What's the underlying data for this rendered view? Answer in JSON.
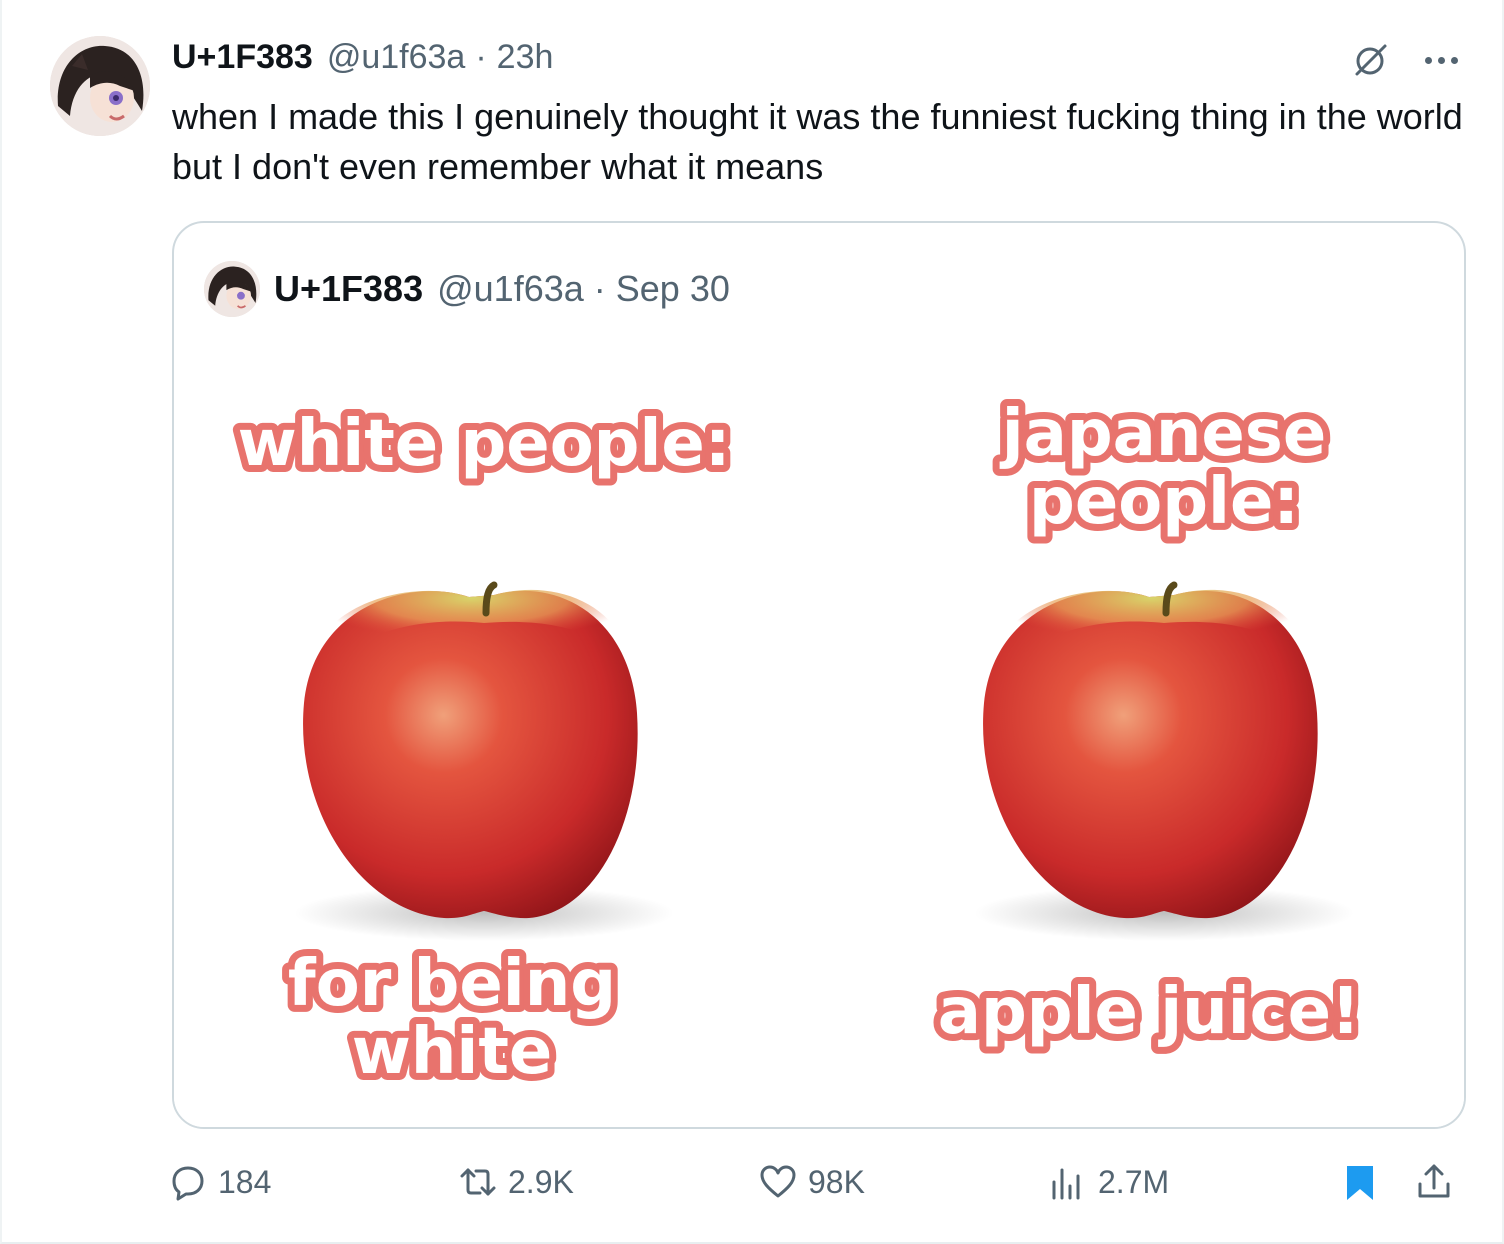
{
  "tweet": {
    "author_name": "U+1F383",
    "author_handle": "@u1f63a",
    "separator": "·",
    "time": "23h",
    "text": "when I made this I genuinely thought it was the funniest fucking thing in the world but I don't even remember what it means"
  },
  "quoted": {
    "author_name": "U+1F383",
    "author_handle": "@u1f63a",
    "separator": "·",
    "date": "Sep 30",
    "meme": {
      "left_top": "white people:",
      "right_top_line1": "japanese",
      "right_top_line2": "people:",
      "left_bottom_line1": "for being",
      "left_bottom_line2": "white",
      "right_bottom": "apple juice!"
    }
  },
  "actions": {
    "replies": "184",
    "reposts": "2.9K",
    "likes": "98K",
    "views": "2.7M"
  },
  "colors": {
    "text_primary": "#0f1419",
    "text_secondary": "#536471",
    "bookmark_active": "#1d9bf0",
    "meme_outline": "#e8736d"
  }
}
